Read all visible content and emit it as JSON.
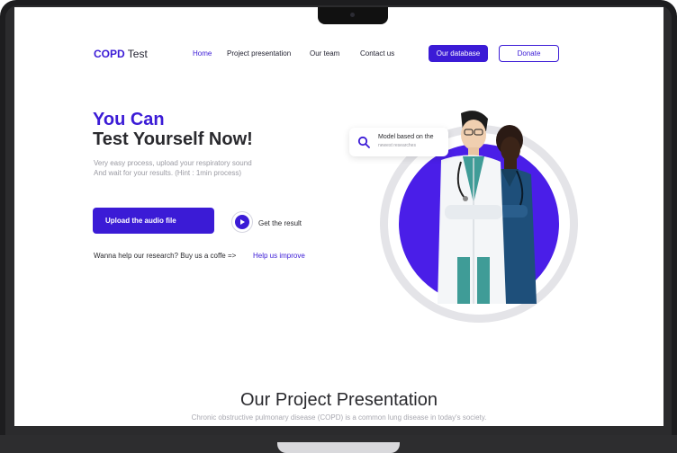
{
  "brand": {
    "strong": "COPD",
    "rest": " Test"
  },
  "nav": {
    "home": "Home",
    "project": "Project presentation",
    "team": "Our team",
    "contact": "Contact us"
  },
  "buttons": {
    "database": "Our database",
    "donate": "Donate",
    "upload": "Upload the audio file"
  },
  "hero": {
    "line1": "You Can",
    "line2": "Test Yourself Now!",
    "desc1": "Very easy process, upload your respiratory sound",
    "desc2": "And wait for your results. (Hint : 1min process)",
    "get_result": "Get the result",
    "coffee": "Wanna help our research? Buy us a coffe =>",
    "help": "Help us improve"
  },
  "card": {
    "title": "Model based on the",
    "subtitle": "newest researches",
    "icon": "search-icon"
  },
  "section": {
    "title": "Our Project Presentation",
    "subtitle": "Chronic obstructive pulmonary disease (COPD) is a common lung disease in today's society."
  },
  "colors": {
    "accent": "#3b1bd6",
    "disc": "#4a1ee8",
    "ring": "#e4e4e8"
  }
}
